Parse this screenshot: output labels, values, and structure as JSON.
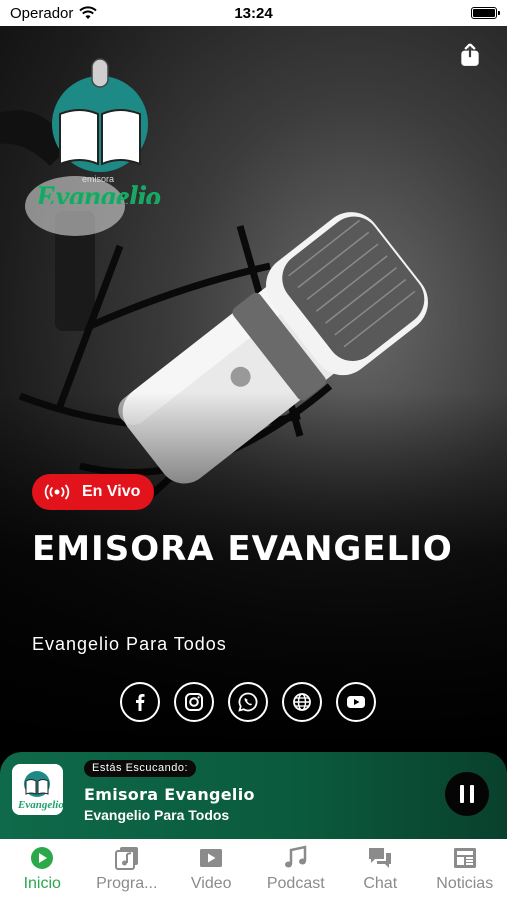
{
  "status_bar": {
    "carrier": "Operador",
    "time": "13:24"
  },
  "hero": {
    "live_label": "En Vivo",
    "station_title": "EMISORA EVANGELIO",
    "station_subtitle": "Evangelio Para Todos",
    "logo_lettering": "emisora Evangelio",
    "social_links": [
      "facebook-icon",
      "instagram-icon",
      "whatsapp-icon",
      "globe-icon",
      "youtube-icon"
    ]
  },
  "player": {
    "listening_label": "Estás Escucando:",
    "title": "Emisora Evangelio",
    "subtitle": "Evangelio Para Todos",
    "state": "playing"
  },
  "tabs": [
    {
      "label": "Inicio",
      "icon": "play-circle-icon",
      "active": true
    },
    {
      "label": "Progra...",
      "icon": "music-note-box-icon",
      "active": false
    },
    {
      "label": "Video",
      "icon": "video-play-icon",
      "active": false
    },
    {
      "label": "Podcast",
      "icon": "music-notes-icon",
      "active": false
    },
    {
      "label": "Chat",
      "icon": "chat-bubbles-icon",
      "active": false
    },
    {
      "label": "Noticias",
      "icon": "newspaper-icon",
      "active": false
    }
  ],
  "colors": {
    "live_badge": "#e3131b",
    "player_bg": "#0b5a3d",
    "tab_active": "#2aa84a",
    "tab_inactive": "#8b8b8b"
  }
}
